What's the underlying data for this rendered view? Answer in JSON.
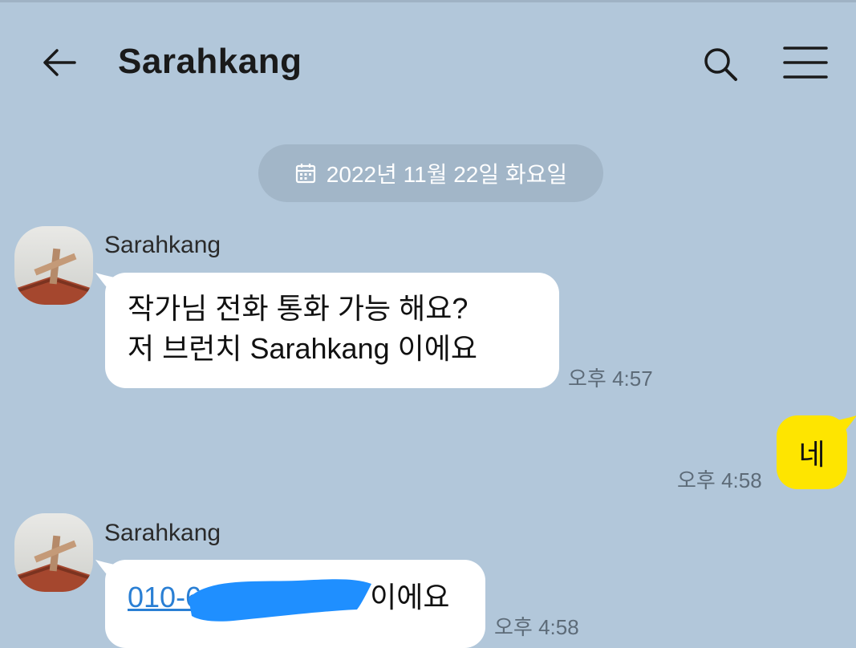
{
  "header": {
    "title": "Sarahkang",
    "back_icon": "arrow-left-icon",
    "search_icon": "search-icon",
    "menu_icon": "hamburger-menu-icon"
  },
  "date_divider": {
    "icon": "calendar-icon",
    "label": "2022년 11월 22일 화요일"
  },
  "messages": [
    {
      "sender": "Sarahkang",
      "lines": [
        "작가님  전화  통화 가능 해요?",
        "저 브런치 Sarahkang 이에요"
      ],
      "time": "오후 4:57"
    },
    {
      "sender": "me",
      "text": "네",
      "time": "오후 4:58"
    },
    {
      "sender": "Sarahkang",
      "phone_visible": "010-6",
      "suffix": " 이에요",
      "time": "오후 4:58"
    }
  ],
  "colors": {
    "background": "#b2c7da",
    "incoming_bubble": "#ffffff",
    "outgoing_bubble": "#fee500",
    "link": "#2a7fd4",
    "redaction": "#1f8fff"
  }
}
